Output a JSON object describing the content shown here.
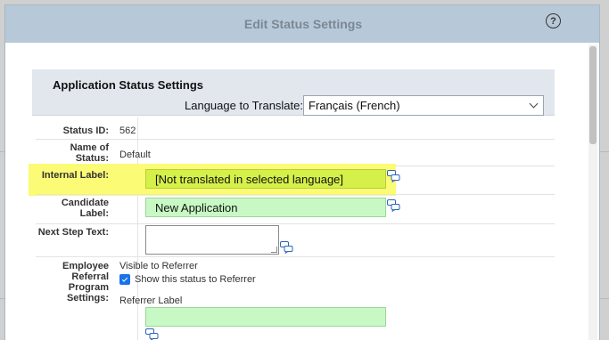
{
  "dialog": {
    "title": "Edit Status Settings",
    "help_symbol": "?"
  },
  "panel": {
    "title": "Application Status Settings",
    "language_label": "Language to Translate:",
    "language_value": "Français (French)"
  },
  "rows": {
    "status_id": {
      "label": "Status ID:",
      "value": "562"
    },
    "name_of_status": {
      "label": "Name of Status:",
      "value": "Default"
    },
    "internal_label": {
      "label": "Internal Label:",
      "value": "[Not translated in selected language]"
    },
    "candidate_label": {
      "label": "Candidate Label:",
      "value": "New Application"
    },
    "next_step_text": {
      "label": "Next Step Text:",
      "value": ""
    },
    "employee_referral": {
      "label": "Employee Referral Program Settings:",
      "visible_label": "Visible to Referrer",
      "checkbox_label": "Show this status to Referrer",
      "checkbox_checked": true,
      "referrer_label_caption": "Referrer Label",
      "referrer_label_value": ""
    }
  },
  "colors": {
    "highlight": "#fbfb75",
    "translated_field": "#c8f9c4",
    "titlebar": "#b7c9d8"
  },
  "icons": {
    "translate": "speech-bubbles-icon",
    "help": "question-circle-icon"
  }
}
